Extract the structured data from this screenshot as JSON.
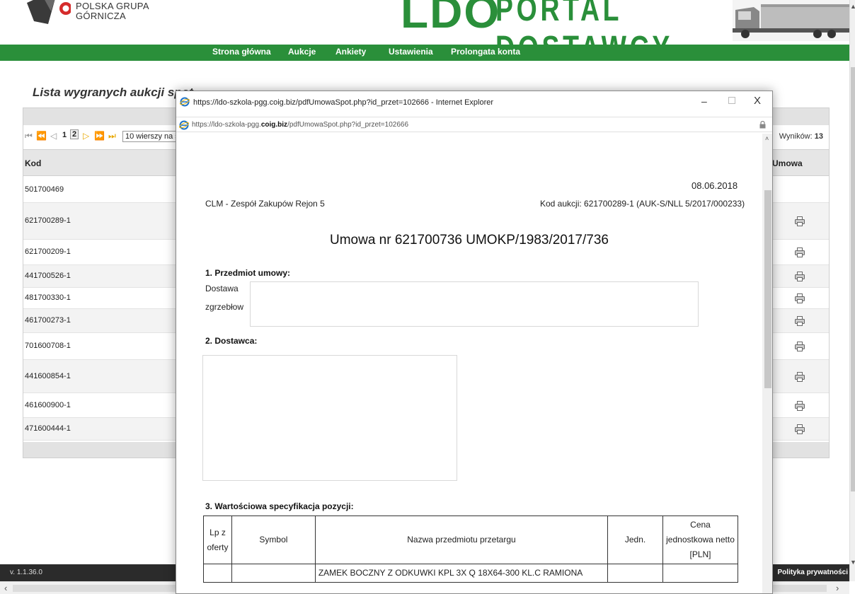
{
  "header": {
    "logo_text_line1": "POLSKA GRUPA",
    "logo_text_line2": "GÓRNICZA",
    "banner_ldo": "LDO",
    "banner_portal": "PORTAL DOSTAWCY"
  },
  "nav": {
    "items": [
      {
        "label": "Strona główna"
      },
      {
        "label": "Aukcje"
      },
      {
        "label": "Ankiety"
      },
      {
        "label": "Ustawienia"
      },
      {
        "label": "Prolongata konta"
      }
    ]
  },
  "list": {
    "title": "Lista wygranych aukcji spot",
    "pager": {
      "page1": "1",
      "page2": "2",
      "rows_per_page": "10 wierszy na s",
      "results_label": "Wyników:",
      "results_count": "13"
    },
    "columns": {
      "kod": "Kod",
      "umowa": "Umowa"
    },
    "rows": [
      {
        "code": "501700469",
        "print": false
      },
      {
        "code": "621700289-1",
        "print": true
      },
      {
        "code": "621700209-1",
        "print": true
      },
      {
        "code": "441700526-1",
        "print": true
      },
      {
        "code": "481700330-1",
        "print": true
      },
      {
        "code": "461700273-1",
        "print": true
      },
      {
        "code": "701600708-1",
        "print": true
      },
      {
        "code": "441600854-1",
        "print": true
      },
      {
        "code": "461600900-1",
        "print": true
      },
      {
        "code": "471600444-1",
        "print": true
      }
    ]
  },
  "footer": {
    "version": "v. 1.1.36.0",
    "privacy": "Polityka prywatności"
  },
  "popup": {
    "title": "https://ldo-szkola-pgg.coig.biz/pdfUmowaSpot.php?id_przet=102666 - Internet Explorer",
    "address_prefix": "https://ldo-szkola-pgg.",
    "address_domain": "coig.biz",
    "address_suffix": "/pdfUmowaSpot.php?id_przet=102666",
    "minimize": "–",
    "close": "X"
  },
  "document": {
    "date": "08.06.2018",
    "buyer": "CLM - Zespół Zakupów Rejon 5",
    "auction_code": "Kod aukcji: 621700289-1 (AUK-S/NLL 5/2017/000233)",
    "heading": "Umowa nr 621700736 UMOKP/1983/2017/736",
    "section1": "1. Przedmiot umowy:",
    "section1_line1": "Dostawa",
    "section1_line2": "zgrzebłow",
    "section2": "2. Dostawca:",
    "section3": "3. Wartościowa specyfikacja pozycji:",
    "table": {
      "col_lp": "Lp z oferty",
      "col_symbol": "Symbol",
      "col_name": "Nazwa przedmiotu przetargu",
      "col_unit": "Jedn.",
      "col_price": "Cena jednostkowa netto [PLN]",
      "row1_name": "ZAMEK BOCZNY Z ODKUWKI KPL 3X Q 18X64-300 KL.C RAMIONA"
    }
  },
  "colors": {
    "brand_green": "#2a8f3a",
    "footer_dark": "#2b2b2b",
    "pager_gold": "#e8a800"
  }
}
